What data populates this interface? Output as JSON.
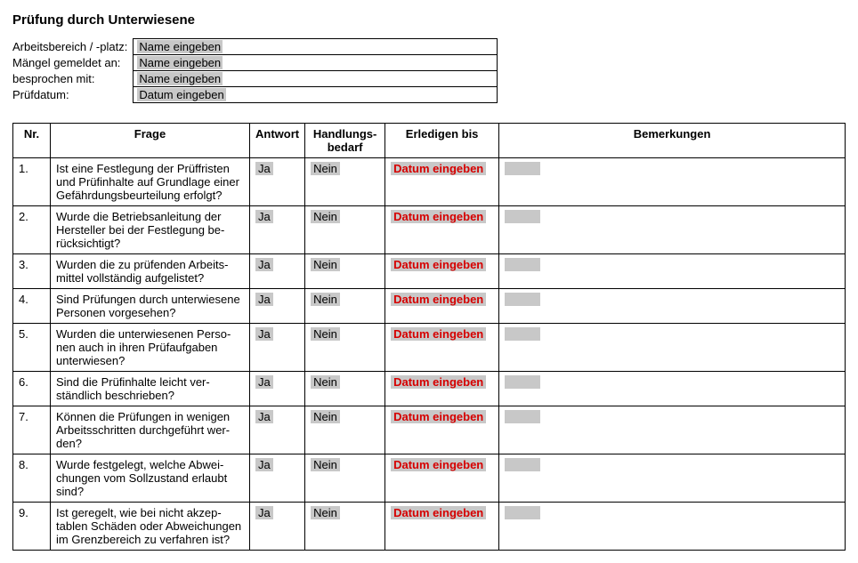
{
  "title": "Prüfung durch Unterwiesene",
  "meta": {
    "rows": [
      {
        "label": "Arbeitsbereich / -platz:",
        "value": "Name eingeben"
      },
      {
        "label": "Mängel gemeldet an:",
        "value": "Name eingeben"
      },
      {
        "label": "besprochen mit:",
        "value": "Name eingeben"
      },
      {
        "label": "Prüfdatum:",
        "value": "Datum eingeben"
      }
    ]
  },
  "columns": {
    "nr": "Nr.",
    "frage": "Frage",
    "antwort": "Antwort",
    "handlung": "Handlungs-\nbedarf",
    "erledigen": "Erledigen bis",
    "bemerkungen": "Bemerkungen"
  },
  "defaults": {
    "antwort": "Ja",
    "handlung": "Nein",
    "erledigen": "Datum eingeben"
  },
  "rows": [
    {
      "nr": "1.",
      "frage": "Ist eine Festlegung der Prüffristen und Prüfinhalte auf Grundlage einer Gefährdungsbeurteilung er­folgt?"
    },
    {
      "nr": "2.",
      "frage": "Wurde die Betriebsanleitung der Hersteller bei der Festlegung be­rücksichtigt?"
    },
    {
      "nr": "3.",
      "frage": "Wurden die zu prüfenden Arbeits­mittel vollständig aufgelistet?"
    },
    {
      "nr": "4.",
      "frage": "Sind Prüfungen durch unterwiese­ne Personen vorgesehen?"
    },
    {
      "nr": "5.",
      "frage": "Wurden die unterwiesenen Perso­nen auch in ihren Prüfaufgaben unterwiesen?"
    },
    {
      "nr": "6.",
      "frage": "Sind die Prüfinhalte leicht ver­ständlich beschrieben?"
    },
    {
      "nr": "7.",
      "frage": "Können die Prüfungen in wenigen Arbeitsschritten durchgeführt wer­den?"
    },
    {
      "nr": "8.",
      "frage": "Wurde festgelegt, welche Abwei­chungen vom Sollzustand erlaubt sind?"
    },
    {
      "nr": "9.",
      "frage": "Ist geregelt, wie bei nicht akzep­tablen Schäden oder Abweichun­gen im Grenzbereich zu verfahren ist?"
    }
  ]
}
